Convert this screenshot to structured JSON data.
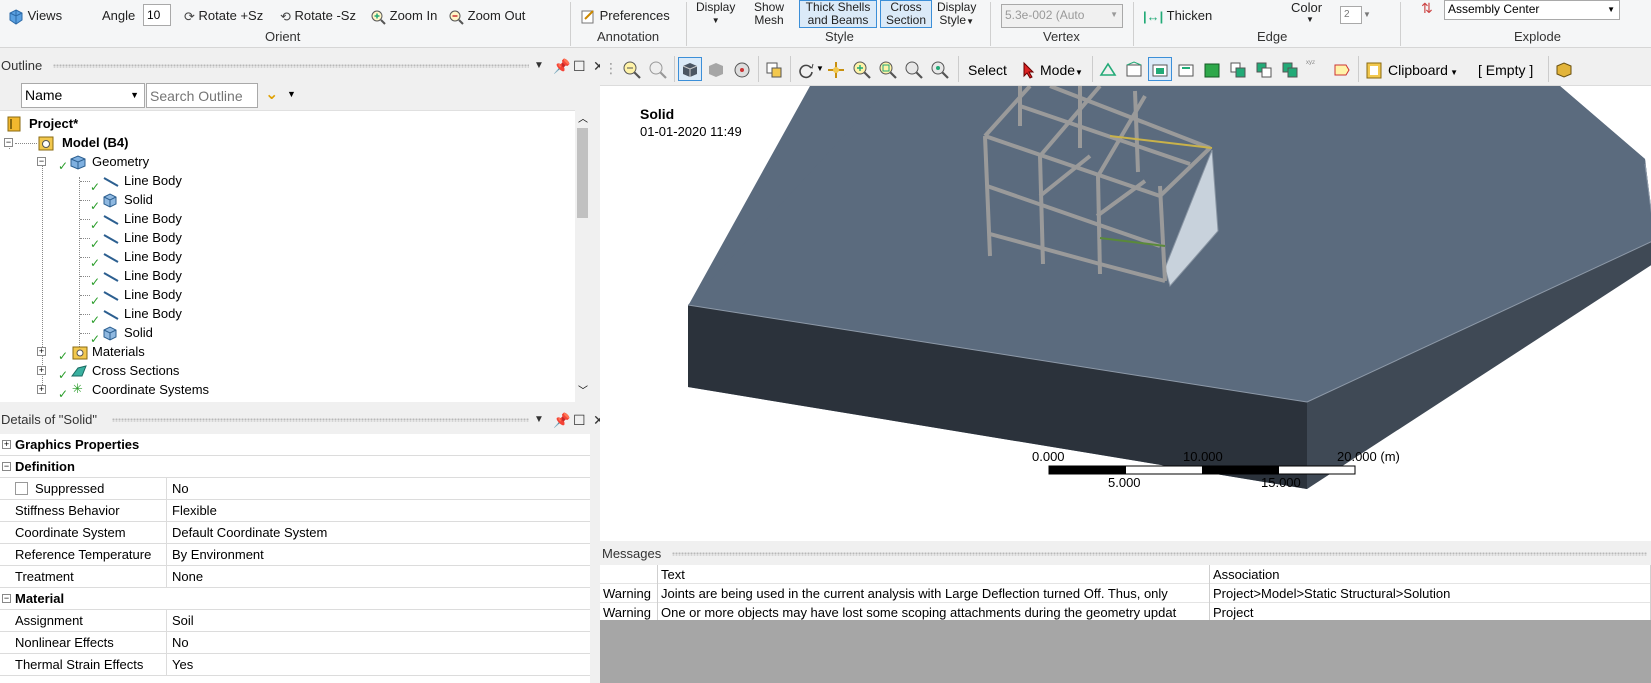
{
  "ribbon": {
    "views": "Views",
    "angle_label": "Angle",
    "angle_value": "10",
    "rotate_plus": "Rotate +Sz",
    "rotate_minus": "Rotate -Sz",
    "zoom_in": "Zoom In",
    "zoom_out": "Zoom Out",
    "orient_group": "Orient",
    "preferences": "Preferences",
    "annotation_group": "Annotation",
    "display": "Display",
    "show_mesh_1": "Show",
    "show_mesh_2": "Mesh",
    "thick_shells_1": "Thick Shells",
    "thick_shells_2": "and Beams",
    "cross_section_1": "Cross",
    "cross_section_2": "Section",
    "display_style_1": "Display",
    "display_style_2": "Style",
    "style_group": "Style",
    "vertex_value": "5.3e-002 (Auto",
    "vertex_group": "Vertex",
    "thicken": "Thicken",
    "color": "Color",
    "color_value": "2",
    "edge_group": "Edge",
    "explode_value": "Assembly Center",
    "explode_group": "Explode"
  },
  "outline": {
    "title": "Outline",
    "name_select": "Name",
    "search_placeholder": "Search Outline",
    "tree": [
      {
        "label": "Project*"
      },
      {
        "label": "Model (B4)"
      },
      {
        "label": "Geometry"
      },
      {
        "label": "Line Body"
      },
      {
        "label": "Solid"
      },
      {
        "label": "Line Body"
      },
      {
        "label": "Line Body"
      },
      {
        "label": "Line Body"
      },
      {
        "label": "Line Body"
      },
      {
        "label": "Line Body"
      },
      {
        "label": "Line Body"
      },
      {
        "label": "Solid"
      },
      {
        "label": "Materials"
      },
      {
        "label": "Cross Sections"
      },
      {
        "label": "Coordinate Systems"
      }
    ]
  },
  "details": {
    "title": "Details of \"Solid\"",
    "rows": [
      {
        "key": "Graphics Properties",
        "value": ""
      },
      {
        "key": "Definition",
        "value": ""
      },
      {
        "key": "Suppressed",
        "value": "No"
      },
      {
        "key": "Stiffness Behavior",
        "value": "Flexible"
      },
      {
        "key": "Coordinate System",
        "value": "Default Coordinate System"
      },
      {
        "key": "Reference Temperature",
        "value": "By Environment"
      },
      {
        "key": "Treatment",
        "value": "None"
      },
      {
        "key": "Material",
        "value": ""
      },
      {
        "key": "Assignment",
        "value": "Soil"
      },
      {
        "key": "Nonlinear Effects",
        "value": "No"
      },
      {
        "key": "Thermal Strain Effects",
        "value": "Yes"
      }
    ]
  },
  "viewport_toolbar": {
    "select": "Select",
    "mode": "Mode",
    "clipboard": "Clipboard",
    "empty": "[ Empty ]"
  },
  "viewport": {
    "title": "Solid",
    "timestamp": "01-01-2020 11:49",
    "scale_labels": [
      "0.000",
      "10.000",
      "20.000 (m)",
      "5.000",
      "15.000"
    ]
  },
  "messages": {
    "title": "Messages",
    "col_text": "Text",
    "col_association": "Association",
    "rows": [
      {
        "type": "Warning",
        "text": "Joints are being used in the current analysis with Large Deflection turned Off.  Thus, only",
        "association": "Project>Model>Static Structural>Solution"
      },
      {
        "type": "Warning",
        "text": "One or more objects may have lost some scoping attachments during the geometry updat",
        "association": "Project"
      }
    ]
  },
  "colors": {
    "block_top": "#5b6b7e",
    "block_front": "#2b323b",
    "block_side": "#3f4955",
    "frame": "#9a9a9a",
    "accent": "#3c8fd8"
  }
}
